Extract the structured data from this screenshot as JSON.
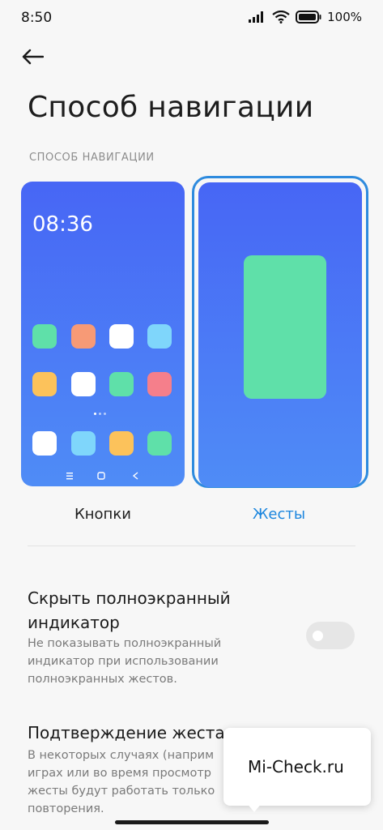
{
  "status_bar": {
    "time": "8:50",
    "battery_text": "100%"
  },
  "header": {
    "title": "Способ навигации"
  },
  "section": {
    "label": "СПОСОБ НАВИГАЦИИ"
  },
  "options": [
    {
      "label": "Кнопки",
      "preview_time": "08:36",
      "selected": false
    },
    {
      "label": "Жесты",
      "selected": true
    }
  ],
  "colors": {
    "accent": "#2e8bde",
    "gesture_shape": "#5fe0a9",
    "preview_bg": "#4766f5"
  },
  "settings": [
    {
      "title_line1": "Скрыть полноэкранный",
      "title_line2": "индикатор",
      "desc_line1": "Не показывать полноэкранный",
      "desc_line2": "индикатор при использовании",
      "desc_line3": "полноэкранных жестов.",
      "toggle_on": false
    },
    {
      "title": "Подтверждение жеста",
      "desc_line1": "В некоторых случаях (наприм",
      "desc_line2": "играх или во время просмотр",
      "desc_line3": "жесты будут работать только",
      "desc_line4": "повторения."
    }
  ],
  "watermark": {
    "text": "Mi-Check.ru"
  }
}
